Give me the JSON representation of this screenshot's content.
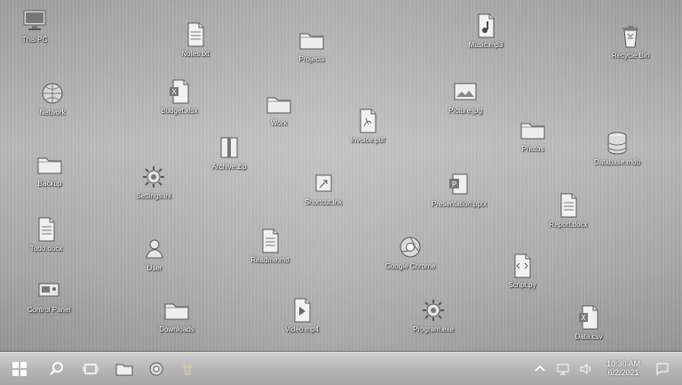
{
  "desktop": {
    "icons": [
      {
        "label": "This PC",
        "icon": "monitor-icon"
      },
      {
        "label": "Notes.txt",
        "icon": "text-file-icon"
      },
      {
        "label": "Projects",
        "icon": "folder-icon"
      },
      {
        "label": "Music.mp3",
        "icon": "music-file-icon"
      },
      {
        "label": "Recycle Bin",
        "icon": "recycle-bin-icon"
      },
      {
        "label": "Network",
        "icon": "globe-icon"
      },
      {
        "label": "Budget.xlsx",
        "icon": "excel-file-icon"
      },
      {
        "label": "Work",
        "icon": "folder-icon"
      },
      {
        "label": "Invoice.pdf",
        "icon": "pdf-file-icon"
      },
      {
        "label": "Picture.jpg",
        "icon": "image-file-icon"
      },
      {
        "label": "Photos",
        "icon": "folder-icon"
      },
      {
        "label": "Database.mdb",
        "icon": "database-icon"
      },
      {
        "label": "Archive.zip",
        "icon": "zip-file-icon"
      },
      {
        "label": "Backup",
        "icon": "folder-icon"
      },
      {
        "label": "Settings.ini",
        "icon": "gear-icon"
      },
      {
        "label": "Shortcut.lnk",
        "icon": "shortcut-icon"
      },
      {
        "label": "Presentation.pptx",
        "icon": "powerpoint-file-icon"
      },
      {
        "label": "Report.docx",
        "icon": "text-file-icon"
      },
      {
        "label": "Todo.docx",
        "icon": "text-file-icon"
      },
      {
        "label": "User",
        "icon": "user-icon"
      },
      {
        "label": "Readme.md",
        "icon": "text-file-icon"
      },
      {
        "label": "Google Chrome",
        "icon": "chrome-icon"
      },
      {
        "label": "Script.py",
        "icon": "code-file-icon"
      },
      {
        "label": "Control Panel",
        "icon": "control-panel-icon"
      },
      {
        "label": "Downloads",
        "icon": "folder-icon"
      },
      {
        "label": "Video.mp4",
        "icon": "video-file-icon"
      },
      {
        "label": "Program.exe",
        "icon": "gear-icon"
      },
      {
        "label": "Data.csv",
        "icon": "excel-file-icon"
      }
    ]
  },
  "taskbar": {
    "clock_time": "10:30 AM",
    "clock_date": "6/2/2021",
    "pinned": [
      {
        "name": "start-button-icon"
      },
      {
        "name": "search-icon"
      },
      {
        "name": "task-view-icon"
      },
      {
        "name": "file-explorer-icon"
      },
      {
        "name": "chrome-icon"
      },
      {
        "name": "deer-app-icon"
      }
    ],
    "tray": [
      {
        "name": "chevron-up-icon"
      },
      {
        "name": "network-icon"
      },
      {
        "name": "volume-icon"
      },
      {
        "name": "notification-icon"
      }
    ]
  }
}
